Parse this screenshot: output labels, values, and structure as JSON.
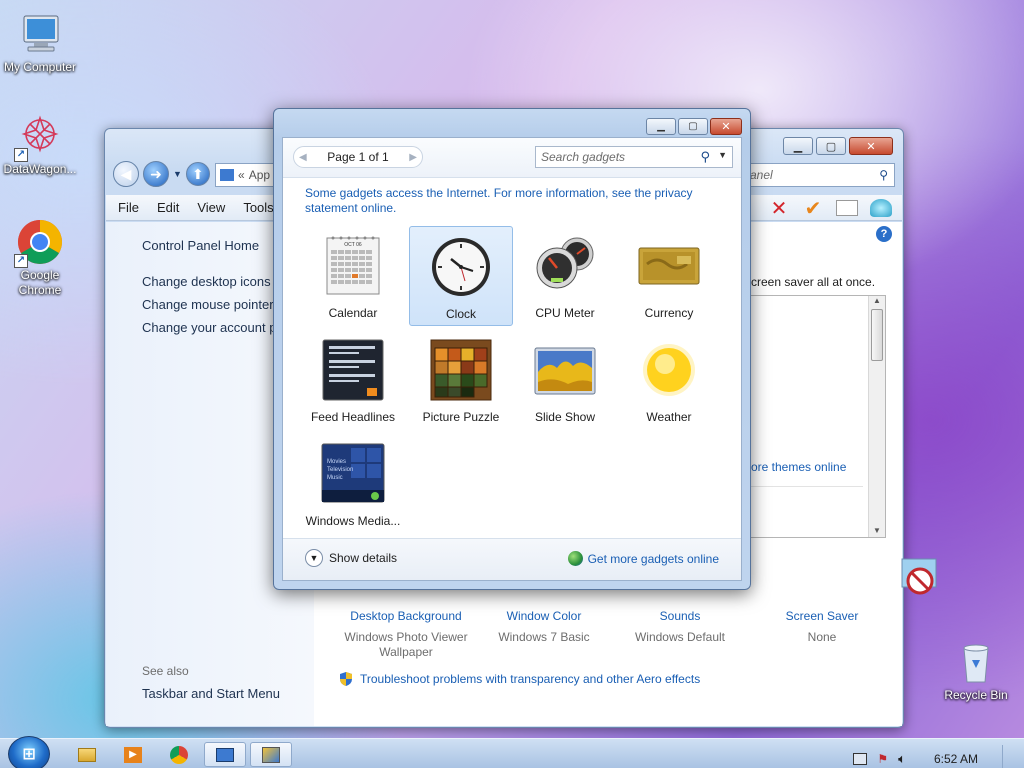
{
  "desktop": {
    "icons": [
      {
        "label": "My Computer"
      },
      {
        "label": "DataWagon..."
      },
      {
        "label": "Google Chrome"
      },
      {
        "label": "Recycle Bin"
      }
    ]
  },
  "background_window": {
    "address_text": "App",
    "search_fragment": "anel",
    "menu": [
      "File",
      "Edit",
      "View",
      "Tools"
    ],
    "left_links": {
      "home": "Control Panel Home",
      "desktop_icons": "Change desktop icons",
      "mouse_pointers": "Change mouse pointers",
      "account_picture": "Change your account pic",
      "see_also": "See also",
      "taskbar": "Taskbar and Start Menu"
    },
    "main": {
      "screen_saver_text": "creen saver all at once.",
      "more_themes": "ore themes online",
      "items": [
        {
          "title": "Desktop Background",
          "sub": "Windows Photo Viewer Wallpaper"
        },
        {
          "title": "Window Color",
          "sub": "Windows 7 Basic"
        },
        {
          "title": "Sounds",
          "sub": "Windows Default"
        },
        {
          "title": "Screen Saver",
          "sub": "None"
        }
      ],
      "troubleshoot": "Troubleshoot problems with transparency and other Aero effects"
    }
  },
  "gadgets_dialog": {
    "pager": "Page 1 of 1",
    "search_placeholder": "Search gadgets",
    "notice": "Some gadgets access the Internet.  For more information, see the privacy statement online.",
    "gadgets": [
      {
        "label": "Calendar"
      },
      {
        "label": "Clock"
      },
      {
        "label": "CPU Meter"
      },
      {
        "label": "Currency"
      },
      {
        "label": "Feed Headlines"
      },
      {
        "label": "Picture Puzzle"
      },
      {
        "label": "Slide Show"
      },
      {
        "label": "Weather"
      },
      {
        "label": "Windows Media..."
      }
    ],
    "calendar_month": "OCT 06",
    "media_lines": [
      "Movies",
      "Television",
      "Music"
    ],
    "show_details": "Show details",
    "get_more": "Get more gadgets online"
  },
  "taskbar": {
    "clock": "6:52 AM"
  },
  "colors": {
    "link_blue": "#1a5fb4",
    "selected_bg": "#cfe3f9"
  }
}
